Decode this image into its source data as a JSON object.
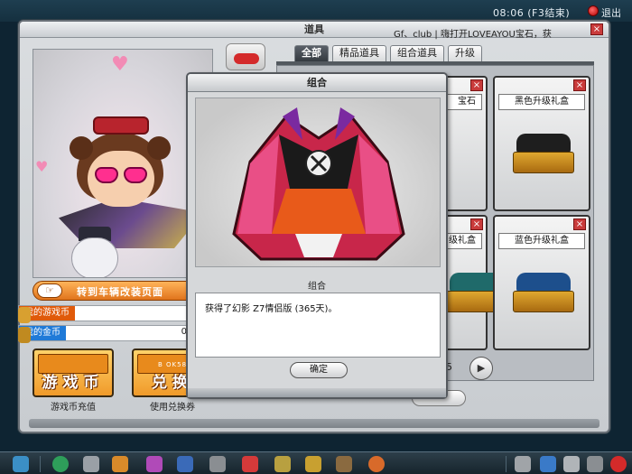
{
  "topbar": {
    "clock": "08:06 (F3结束)",
    "exit_label": "退出"
  },
  "main_window": {
    "title": "道具",
    "ticker": "Gf、club | 嗨打开LOVEAYOU宝石，获"
  },
  "left_panel": {
    "banner_label": "转到车辆改装页面",
    "game_coin_label": "我的游戏币",
    "game_coin_value": "",
    "gold_coin_label": "我的金币",
    "gold_coin_value": "0",
    "recharge_button_text": "游戏币",
    "recharge_caption": "游戏币充值",
    "exchange_button_text": "兑换",
    "exchange_caption": "使用兑换券",
    "barcode_text": "B OK58"
  },
  "tabs": [
    {
      "label": "全部",
      "active": true
    },
    {
      "label": "精品道具",
      "active": false
    },
    {
      "label": "组合道具",
      "active": false
    },
    {
      "label": "升级",
      "active": false
    }
  ],
  "item_cards": [
    {
      "name": "宝石",
      "close": "×"
    },
    {
      "name": "黑色升级礼盒",
      "close": "×"
    },
    {
      "name": "级礼盒",
      "close": "×"
    },
    {
      "name": "蓝色升级礼盒",
      "close": "×"
    }
  ],
  "pager": {
    "page_num": "5",
    "next_symbol": "▶"
  },
  "dialog": {
    "title": "组合",
    "caption": "组合",
    "message": "获得了幻影 Z7情侣版 (365天)。",
    "ok_label": "确定"
  },
  "colors": {
    "tab_active": "#3e444a",
    "game_coin_label_bg": "#e05a0a",
    "gold_coin_label_bg": "#1f7ad8",
    "button_orange": "#f09a2a",
    "close_red": "#c93b3b"
  },
  "icons": {
    "main_close": "×",
    "exit": "red-circle-icon",
    "banner": "pointing-hand-icon"
  }
}
